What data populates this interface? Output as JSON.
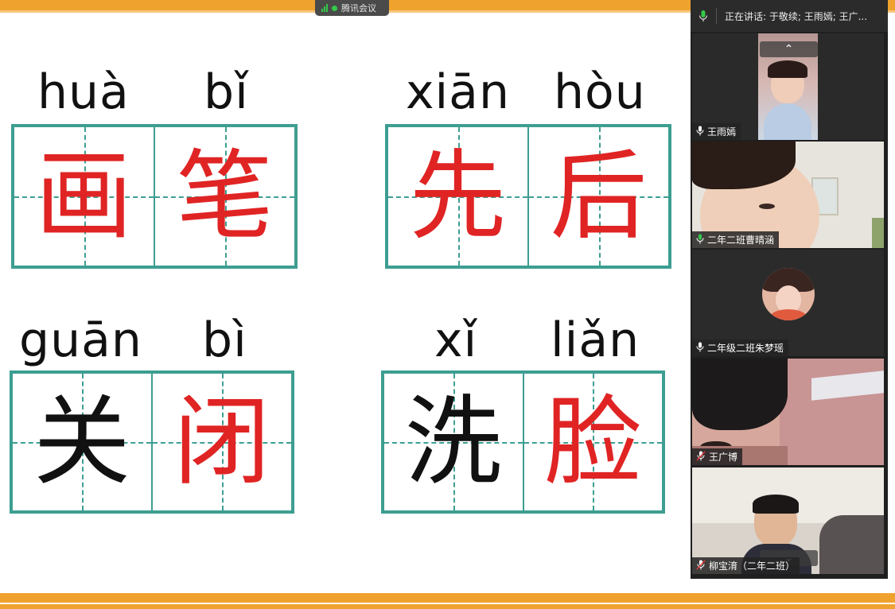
{
  "meeting_app": {
    "name": "腾讯会议"
  },
  "lesson": {
    "words": [
      {
        "pinyin": [
          "huà",
          "bǐ"
        ],
        "chars": [
          "画",
          "笔"
        ],
        "colors": [
          "red",
          "red"
        ]
      },
      {
        "pinyin": [
          "xiān",
          "hòu"
        ],
        "chars": [
          "先",
          "后"
        ],
        "colors": [
          "red",
          "red"
        ]
      },
      {
        "pinyin": [
          "guān",
          "bì"
        ],
        "chars": [
          "关",
          "闭"
        ],
        "colors": [
          "black",
          "red"
        ]
      },
      {
        "pinyin": [
          "xǐ",
          "liǎn"
        ],
        "chars": [
          "洗",
          "脸"
        ],
        "colors": [
          "black",
          "red"
        ]
      }
    ]
  },
  "panel": {
    "speaking_text": "正在讲话: 于敬续; 王雨嫣; 王广...",
    "participants": [
      {
        "name": "王雨嫣",
        "mic": "on"
      },
      {
        "name": "二年二班曹晴涵",
        "mic": "active"
      },
      {
        "name": "二年级二班朱梦瑶",
        "mic": "on"
      },
      {
        "name": "王广博",
        "mic": "muted"
      },
      {
        "name": "柳宝淯（二年二班）",
        "mic": "muted"
      }
    ]
  },
  "colors": {
    "accent_orange": "#f0a22e",
    "grid_teal": "#3d9e91",
    "char_red": "#e02424",
    "speaking_green": "#34c94a"
  }
}
